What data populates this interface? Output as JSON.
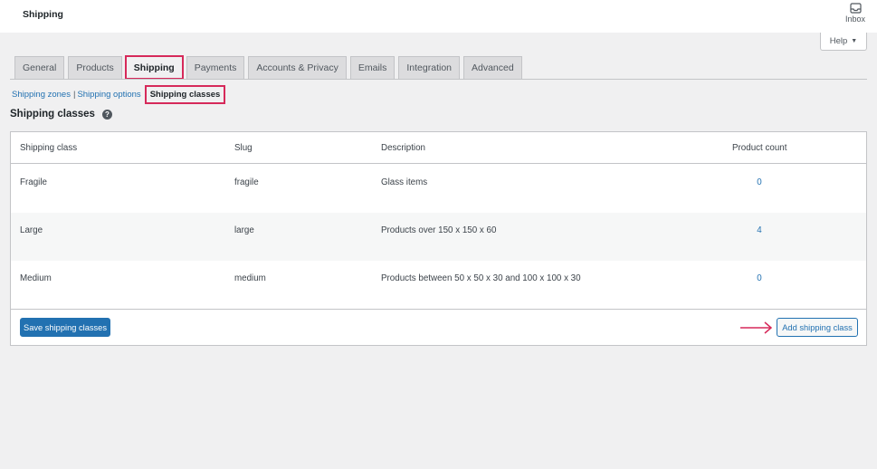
{
  "header": {
    "title": "Shipping",
    "inbox_label": "Inbox",
    "help_label": "Help"
  },
  "tabs": [
    {
      "label": "General"
    },
    {
      "label": "Products"
    },
    {
      "label": "Shipping"
    },
    {
      "label": "Payments"
    },
    {
      "label": "Accounts & Privacy"
    },
    {
      "label": "Emails"
    },
    {
      "label": "Integration"
    },
    {
      "label": "Advanced"
    }
  ],
  "subnav": {
    "zones": "Shipping zones",
    "separator": "|",
    "options": "Shipping options",
    "classes": "Shipping classes"
  },
  "section": {
    "title": "Shipping classes",
    "help_icon": "?"
  },
  "table": {
    "columns": [
      "Shipping class",
      "Slug",
      "Description",
      "Product count"
    ],
    "rows": [
      {
        "name": "Fragile",
        "slug": "fragile",
        "description": "Glass items",
        "count": "0"
      },
      {
        "name": "Large",
        "slug": "large",
        "description": "Products over 150 x 150 x 60",
        "count": "4"
      },
      {
        "name": "Medium",
        "slug": "medium",
        "description": "Products between 50 x 50 x 30 and 100 x 100 x 30",
        "count": "0"
      }
    ]
  },
  "footer": {
    "save_label": "Save shipping classes",
    "add_label": "Add shipping class"
  },
  "colors": {
    "accent": "#2271b1",
    "highlight": "#d6295a",
    "background": "#f0f0f1"
  },
  "icons": {
    "inbox": "inbox-icon",
    "help": "question-circle-icon",
    "caret": "caret-down-icon",
    "arrow": "arrow-right-icon"
  }
}
